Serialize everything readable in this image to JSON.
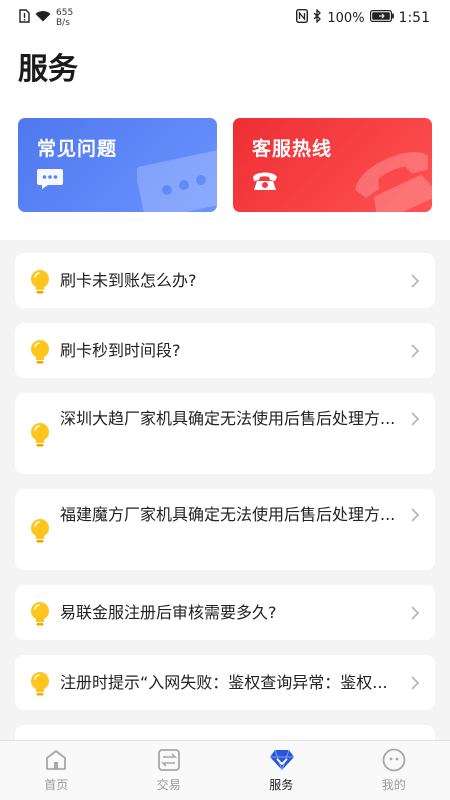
{
  "status_bar": {
    "speed_value": "655",
    "speed_unit": "B/s",
    "battery": "100%",
    "time": "1:51"
  },
  "header": {
    "title": "服务"
  },
  "cards": [
    {
      "label": "常见问题",
      "icon": "chat-bubble-icon",
      "color": "#5a82f2"
    },
    {
      "label": "客服热线",
      "icon": "telephone-icon",
      "color": "#f33a3d"
    }
  ],
  "faq_items": [
    {
      "text": "刷卡未到账怎么办?"
    },
    {
      "text": "刷卡秒到时间段?"
    },
    {
      "text": "深圳大趋厂家机具确定无法使用后售后处理方..."
    },
    {
      "text": "福建魔方厂家机具确定无法使用后售后处理方..."
    },
    {
      "text": "易联金服注册后审核需要多久?"
    },
    {
      "text": "注册时提示“入网失败：鉴权查询异常：鉴权..."
    }
  ],
  "bottom_nav": {
    "items": [
      {
        "label": "首页",
        "icon": "home-icon",
        "active": false
      },
      {
        "label": "交易",
        "icon": "transaction-icon",
        "active": false
      },
      {
        "label": "服务",
        "icon": "service-diamond-icon",
        "active": true
      },
      {
        "label": "我的",
        "icon": "profile-icon",
        "active": false
      }
    ]
  },
  "colors": {
    "accent": "#2f6bf0",
    "bulb": "#ffc51c",
    "active_icon": "#2955d6"
  }
}
